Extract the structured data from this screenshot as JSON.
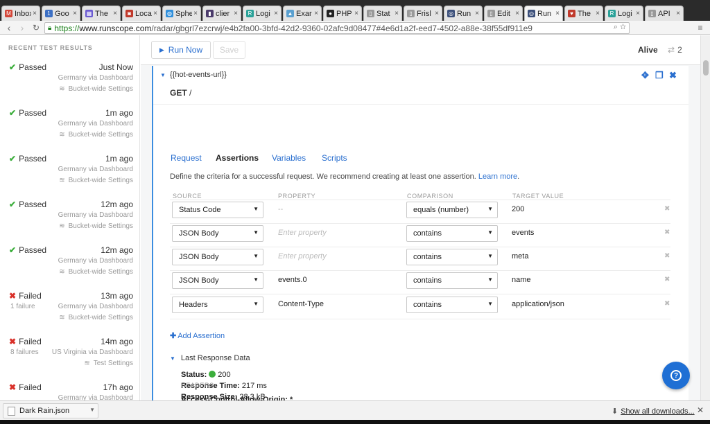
{
  "browser": {
    "tabs": [
      {
        "title": "Inbox",
        "fav": "M",
        "color": "#d44638"
      },
      {
        "title": "Goo",
        "fav": "1",
        "color": "#3b6fc4"
      },
      {
        "title": "The",
        "fav": "▦",
        "color": "#6b5bd2"
      },
      {
        "title": "Loca",
        "fav": "◙",
        "color": "#c0392b"
      },
      {
        "title": "Sphe",
        "fav": "◍",
        "color": "#2f8fdc"
      },
      {
        "title": "clier",
        "fav": "▮",
        "color": "#4b3b6b"
      },
      {
        "title": "Logi",
        "fav": "R",
        "color": "#2aa198"
      },
      {
        "title": "Exar",
        "fav": "▲",
        "color": "#5aa0d0"
      },
      {
        "title": "PHP",
        "fav": "●",
        "color": "#222222"
      },
      {
        "title": "Stat",
        "fav": "▯",
        "color": "#999999"
      },
      {
        "title": "Frisl",
        "fav": "▯",
        "color": "#999999"
      },
      {
        "title": "Run",
        "fav": "◎",
        "color": "#3b4f7a"
      },
      {
        "title": "Edit",
        "fav": "▯",
        "color": "#999999"
      },
      {
        "title": "Run",
        "fav": "◎",
        "color": "#3b4f7a",
        "active": true
      },
      {
        "title": "The",
        "fav": "♥",
        "color": "#c0392b"
      },
      {
        "title": "Logi",
        "fav": "R",
        "color": "#2aa198"
      },
      {
        "title": "API",
        "fav": "▯",
        "color": "#999999"
      }
    ],
    "url_scheme": "https://",
    "url_host": "www.runscope.com",
    "url_path": "/radar/gbgrl7ezcrwj/e4b2fa00-3bfd-42d2-9360-02afc9d08477#4e6d1a2f-eed7-4502-a88e-38f55df911e9"
  },
  "sidebar": {
    "title": "RECENT TEST RESULTS",
    "results": [
      {
        "status": "Passed",
        "ok": true,
        "time": "Just Now",
        "failures": "",
        "location": "Germany via Dashboard",
        "settings": "Bucket-wide Settings"
      },
      {
        "status": "Passed",
        "ok": true,
        "time": "1m ago",
        "failures": "",
        "location": "Germany via Dashboard",
        "settings": "Bucket-wide Settings"
      },
      {
        "status": "Passed",
        "ok": true,
        "time": "1m ago",
        "failures": "",
        "location": "Germany via Dashboard",
        "settings": "Bucket-wide Settings"
      },
      {
        "status": "Passed",
        "ok": true,
        "time": "12m ago",
        "failures": "",
        "location": "Germany via Dashboard",
        "settings": "Bucket-wide Settings"
      },
      {
        "status": "Passed",
        "ok": true,
        "time": "12m ago",
        "failures": "",
        "location": "Germany via Dashboard",
        "settings": "Bucket-wide Settings"
      },
      {
        "status": "Failed",
        "ok": false,
        "time": "13m ago",
        "failures": "1 failure",
        "location": "Germany via Dashboard",
        "settings": "Bucket-wide Settings"
      },
      {
        "status": "Failed",
        "ok": false,
        "time": "14m ago",
        "failures": "8 failures",
        "location": "US Virginia via Dashboard",
        "settings": "Test Settings"
      },
      {
        "status": "Failed",
        "ok": false,
        "time": "17h ago",
        "failures": "",
        "location": "Germany via Dashboard",
        "settings": ""
      }
    ]
  },
  "topbar": {
    "run_label": "Run Now",
    "save_label": "Save",
    "alive_label": "Alive",
    "count": "2"
  },
  "step": {
    "url": "{{hot-events-url}}",
    "method": "GET",
    "path": "/",
    "tabs": [
      "Request",
      "Assertions",
      "Variables",
      "Scripts"
    ],
    "active_tab": "Assertions",
    "description": "Define the criteria for a successful request. We recommend creating at least one assertion.",
    "learn_more": "Learn more",
    "columns": [
      "SOURCE",
      "PROPERTY",
      "COMPARISON",
      "TARGET VALUE"
    ],
    "assertions": [
      {
        "source": "Status Code",
        "property": "--",
        "property_kind": "dash",
        "comparison": "equals (number)",
        "target": "200"
      },
      {
        "source": "JSON Body",
        "property": "Enter property",
        "property_kind": "placeholder",
        "comparison": "contains",
        "target": "events"
      },
      {
        "source": "JSON Body",
        "property": "Enter property",
        "property_kind": "placeholder",
        "comparison": "contains",
        "target": "meta"
      },
      {
        "source": "JSON Body",
        "property": "events.0",
        "property_kind": "value",
        "comparison": "contains",
        "target": "name"
      },
      {
        "source": "Headers",
        "property": "Content-Type",
        "property_kind": "value",
        "comparison": "contains",
        "target": "application/json"
      }
    ],
    "add_assertion": "Add Assertion",
    "last_response_title": "Last Response Data",
    "status_label": "Status:",
    "status_value": "200",
    "response_time_label": "Response Time:",
    "response_time_value": "217 ms",
    "response_size_label": "Response Size:",
    "response_size_value": "28.3 kB",
    "headers_title": "HEADERS",
    "first_header": "Access-Control-Allow-Origin: *"
  },
  "downloads": {
    "file": "Dark Rain.json",
    "show_all": "Show all downloads..."
  },
  "colors": {
    "accent": "#2a6fcf",
    "pass": "#3cae3c",
    "fail": "#d9312a"
  }
}
